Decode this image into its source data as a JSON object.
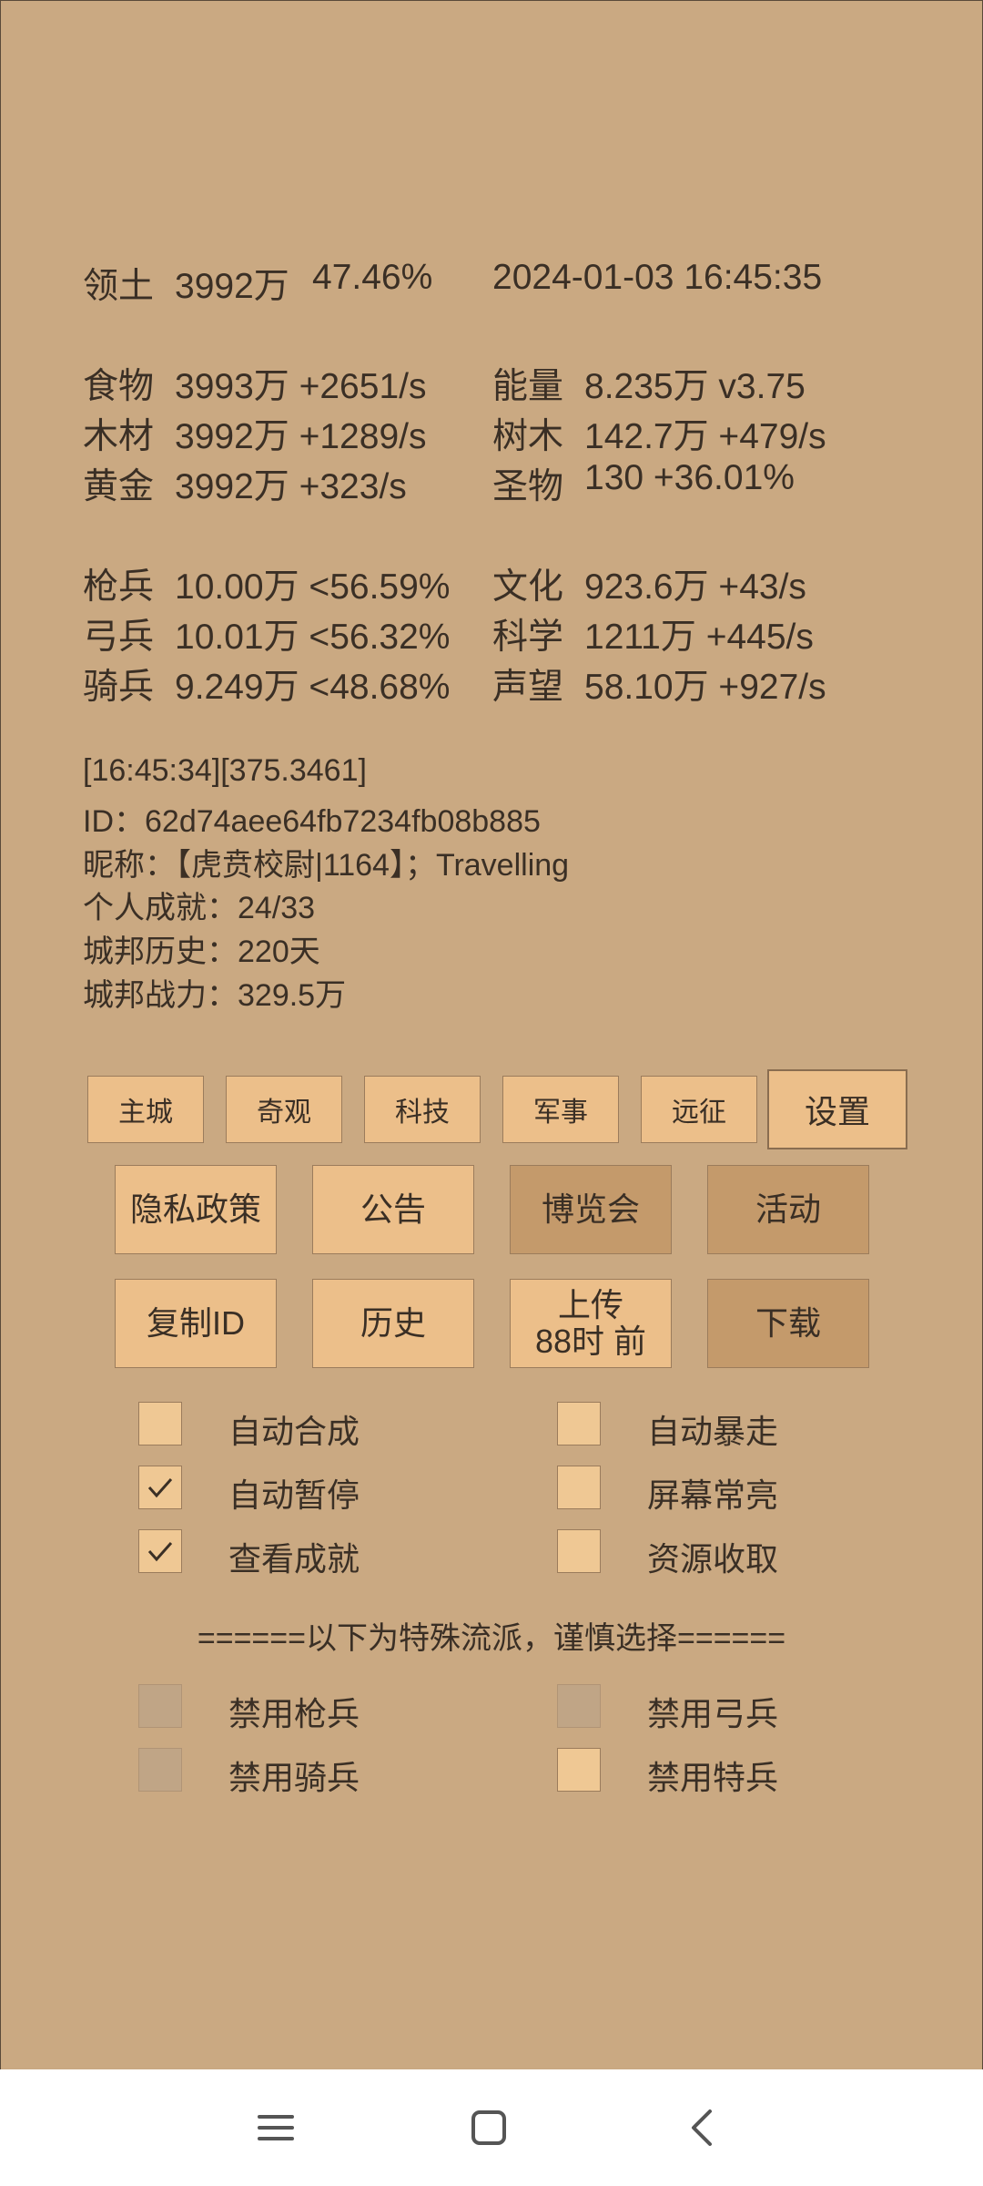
{
  "header": {
    "territory_label": "领土",
    "territory_value": "3992万",
    "territory_pct": "47.46%",
    "datetime": "2024-01-03 16:45:35"
  },
  "resources": [
    {
      "label": "食物",
      "value": "3993万 +2651/s",
      "label2": "能量",
      "value2": "8.235万  v3.75"
    },
    {
      "label": "木材",
      "value": "3992万 +1289/s",
      "label2": "树木",
      "value2": "142.7万 +479/s"
    },
    {
      "label": "黄金",
      "value": "3992万 +323/s",
      "label2": "圣物",
      "value2": "130 +36.01%"
    }
  ],
  "troops": [
    {
      "label": "枪兵",
      "value": "10.00万 <56.59%",
      "label2": "文化",
      "value2": "923.6万 +43/s"
    },
    {
      "label": "弓兵",
      "value": "10.01万 <56.32%",
      "label2": "科学",
      "value2": "1211万 +445/s"
    },
    {
      "label": "骑兵",
      "value": "9.249万 <48.68%",
      "label2": "声望",
      "value2": "58.10万 +927/s"
    }
  ],
  "info": {
    "timestamp": "[16:45:34][375.3461]",
    "id_line": "ID：62d74aee64fb7234fb08b885",
    "nickname_line": "昵称：【虎贲校尉|1164】；Travelling",
    "achievement_line": "个人成就：24/33",
    "history_line": "城邦历史：220天",
    "power_line": "城邦战力：329.5万"
  },
  "tabs": [
    "主城",
    "奇观",
    "科技",
    "军事",
    "远征",
    "设置"
  ],
  "buttons_row1": [
    "隐私政策",
    "公告",
    "博览会",
    "活动"
  ],
  "buttons_row2": {
    "copy_id": "复制ID",
    "history": "历史",
    "upload_line1": "上传",
    "upload_line2": "88时 前",
    "download": "下载"
  },
  "options": [
    {
      "label": "自动合成",
      "checked": false
    },
    {
      "label": "自动暴走",
      "checked": false
    },
    {
      "label": "自动暂停",
      "checked": true
    },
    {
      "label": "屏幕常亮",
      "checked": false
    },
    {
      "label": "查看成就",
      "checked": true
    },
    {
      "label": "资源收取",
      "checked": false
    }
  ],
  "special_divider": "======以下为特殊流派，谨慎选择======",
  "special_options": [
    {
      "label": "禁用枪兵",
      "checked": false,
      "enabled": false
    },
    {
      "label": "禁用弓兵",
      "checked": false,
      "enabled": false
    },
    {
      "label": "禁用骑兵",
      "checked": false,
      "enabled": false
    },
    {
      "label": "禁用特兵",
      "checked": false,
      "enabled": true
    }
  ],
  "navbar": {
    "icons": [
      "menu-icon",
      "home-icon",
      "back-icon"
    ]
  },
  "colors": {
    "background": "#caa982",
    "button": "#ecbf8a",
    "button_dark": "#c49a6b",
    "text": "#3a2f25"
  }
}
